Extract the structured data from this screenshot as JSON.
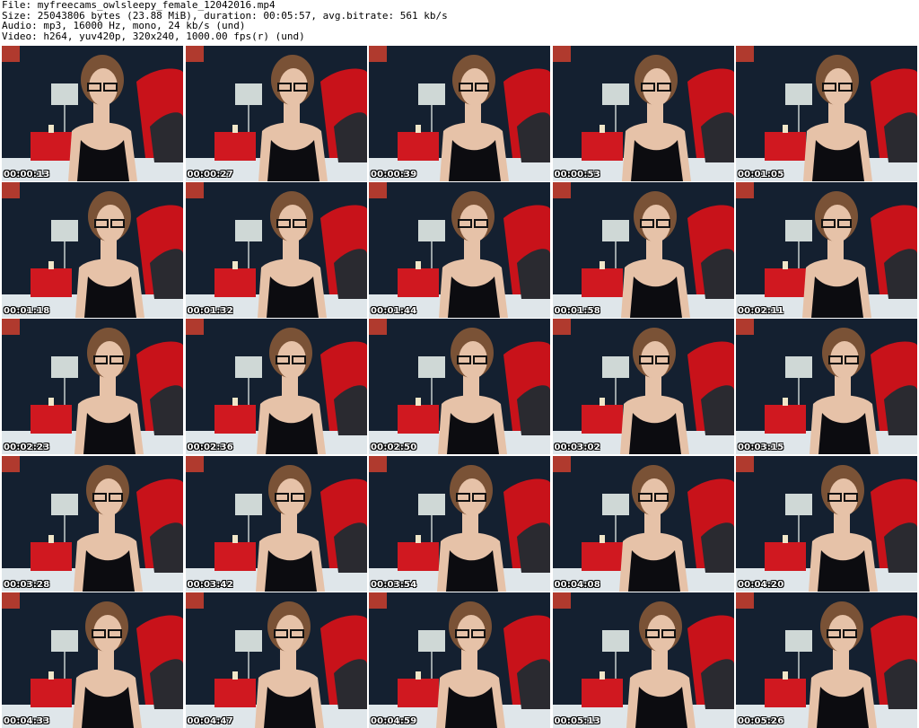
{
  "header": {
    "file_line": "File: myfreecams_owlsleepy_female_12042016.mp4",
    "size_line": "Size: 25043806 bytes (23.88 MiB), duration: 00:05:57, avg.bitrate: 561 kb/s",
    "audio_line": "Audio: mp3, 16000 Hz, mono, 24 kb/s (und)",
    "video_line": "Video: h264, yuv420p, 320x240, 1000.00 fps(r) (und)"
  },
  "colors": {
    "wall": "#142030",
    "red_bed": "#c8121a",
    "red_table": "#d01820",
    "lamp": "#cfd8d6",
    "skin": "#e6c2a8",
    "hair": "#7a5236",
    "top": "#0c0c10",
    "sheet": "#dfe6ea",
    "pillow": "#2a2a30"
  },
  "thumbnails": [
    {
      "timestamp": "00:00:13"
    },
    {
      "timestamp": "00:00:27"
    },
    {
      "timestamp": "00:00:39"
    },
    {
      "timestamp": "00:00:53"
    },
    {
      "timestamp": "00:01:05"
    },
    {
      "timestamp": "00:01:18"
    },
    {
      "timestamp": "00:01:32"
    },
    {
      "timestamp": "00:01:44"
    },
    {
      "timestamp": "00:01:58"
    },
    {
      "timestamp": "00:02:11"
    },
    {
      "timestamp": "00:02:23"
    },
    {
      "timestamp": "00:02:36"
    },
    {
      "timestamp": "00:02:50"
    },
    {
      "timestamp": "00:03:02"
    },
    {
      "timestamp": "00:03:15"
    },
    {
      "timestamp": "00:03:28"
    },
    {
      "timestamp": "00:03:42"
    },
    {
      "timestamp": "00:03:54"
    },
    {
      "timestamp": "00:04:08"
    },
    {
      "timestamp": "00:04:20"
    },
    {
      "timestamp": "00:04:33"
    },
    {
      "timestamp": "00:04:47"
    },
    {
      "timestamp": "00:04:59"
    },
    {
      "timestamp": "00:05:13"
    },
    {
      "timestamp": "00:05:26"
    }
  ]
}
